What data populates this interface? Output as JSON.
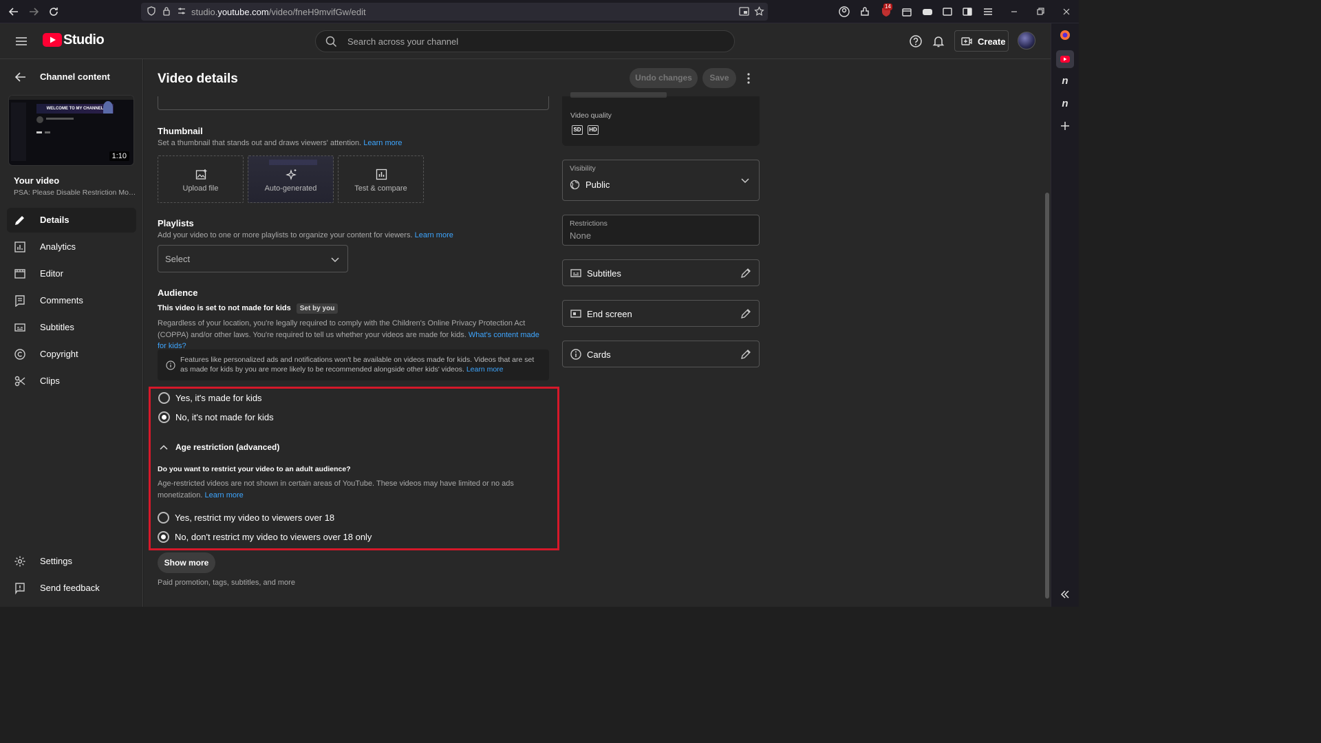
{
  "browser": {
    "url_prefix": "studio.",
    "url_domain": "youtube.com",
    "url_path": "/video/fneH9mvifGw/edit",
    "extension_badge": "14"
  },
  "header": {
    "brand": "Studio",
    "search_placeholder": "Search across your channel",
    "create_label": "Create"
  },
  "left_nav": {
    "back_label": "Channel content",
    "thumb_duration": "1:10",
    "thumb_banner": "WELCOME TO MY CHANNEL",
    "your_video": "Your video",
    "video_title": "PSA: Please Disable Restriction Mod...",
    "items": [
      {
        "label": "Details",
        "icon": "pencil-icon"
      },
      {
        "label": "Analytics",
        "icon": "analytics-icon"
      },
      {
        "label": "Editor",
        "icon": "editor-icon"
      },
      {
        "label": "Comments",
        "icon": "comments-icon"
      },
      {
        "label": "Subtitles",
        "icon": "subtitles-icon"
      },
      {
        "label": "Copyright",
        "icon": "copyright-icon"
      },
      {
        "label": "Clips",
        "icon": "scissors-icon"
      }
    ],
    "settings": "Settings",
    "feedback": "Send feedback"
  },
  "main": {
    "title": "Video details",
    "undo": "Undo changes",
    "save": "Save",
    "thumbnail": {
      "heading": "Thumbnail",
      "desc": "Set a thumbnail that stands out and draws viewers' attention.",
      "learn_more": "Learn more",
      "tiles": [
        "Upload file",
        "Auto-generated",
        "Test & compare"
      ]
    },
    "playlists": {
      "heading": "Playlists",
      "desc": "Add your video to one or more playlists to organize your content for viewers.",
      "learn_more": "Learn more",
      "select": "Select"
    },
    "audience": {
      "heading": "Audience",
      "status": "This video is set to not made for kids",
      "chip": "Set by you",
      "desc": "Regardless of your location, you're legally required to comply with the Children's Online Privacy Protection Act (COPPA) and/or other laws. You're required to tell us whether your videos are made for kids.",
      "desc_link": "What's content made for kids?",
      "info": "Features like personalized ads and notifications won't be available on videos made for kids. Videos that are set as made for kids by you are more likely to be recommended alongside other kids' videos.",
      "info_link": "Learn more",
      "opt_yes": "Yes, it's made for kids",
      "opt_no": "No, it's not made for kids",
      "age_toggle": "Age restriction (advanced)",
      "age_q": "Do you want to restrict your video to an adult audience?",
      "age_desc": "Age-restricted videos are not shown in certain areas of YouTube. These videos may have limited or no ads monetization.",
      "age_link": "Learn more",
      "age_yes": "Yes, restrict my video to viewers over 18",
      "age_no": "No, don't restrict my video to viewers over 18 only"
    },
    "show_more": "Show more",
    "show_more_desc": "Paid promotion, tags, subtitles, and more"
  },
  "panel": {
    "quality_label": "Video quality",
    "quality_sd": "SD",
    "quality_hd": "HD",
    "visibility_label": "Visibility",
    "visibility_value": "Public",
    "restrictions_label": "Restrictions",
    "restrictions_value": "None",
    "subtitles": "Subtitles",
    "end_screen": "End screen",
    "cards": "Cards"
  }
}
